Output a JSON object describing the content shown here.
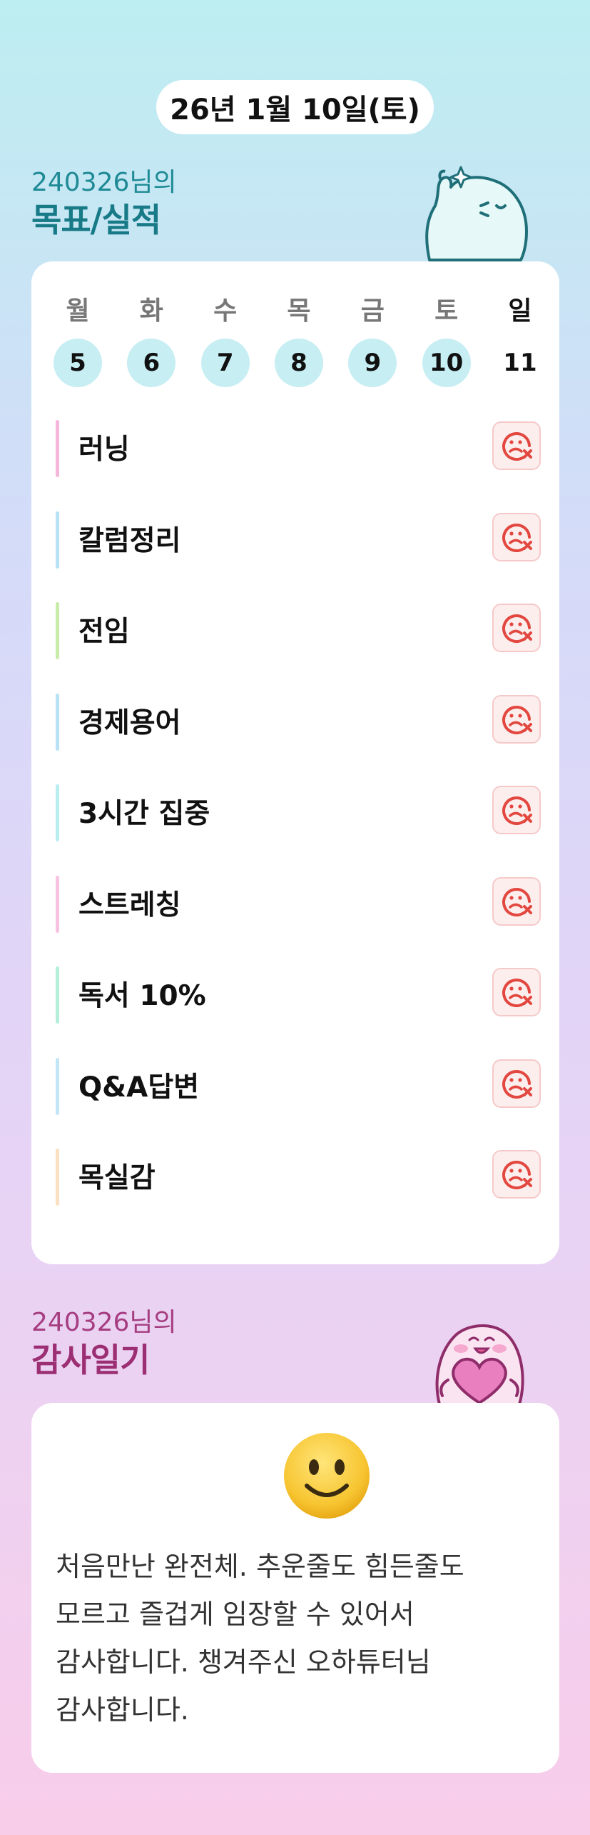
{
  "date_label": "26년 1월 10일(토)",
  "goals_section": {
    "user_line": "240326님의",
    "title": "목표/실적"
  },
  "week": {
    "days": [
      {
        "name": "월",
        "num": "5"
      },
      {
        "name": "화",
        "num": "6"
      },
      {
        "name": "수",
        "num": "7"
      },
      {
        "name": "목",
        "num": "8"
      },
      {
        "name": "금",
        "num": "9"
      },
      {
        "name": "토",
        "num": "10"
      },
      {
        "name": "일",
        "num": "11"
      }
    ]
  },
  "goals": [
    {
      "label": "러닝",
      "color": "#f6b6dc",
      "status": "sad-x-icon"
    },
    {
      "label": "칼럼정리",
      "color": "#b9e2f6",
      "status": "sad-x-icon"
    },
    {
      "label": "전임",
      "color": "#c8ecaa",
      "status": "sad-x-icon"
    },
    {
      "label": "경제용어",
      "color": "#b9e2f6",
      "status": "sad-x-icon"
    },
    {
      "label": "3시간 집중",
      "color": "#b8eef0",
      "status": "sad-x-icon"
    },
    {
      "label": "스트레칭",
      "color": "#f8c2e2",
      "status": "sad-x-icon"
    },
    {
      "label": "독서 10%",
      "color": "#b5efd9",
      "status": "sad-x-icon"
    },
    {
      "label": "Q&A답변",
      "color": "#c2e6f7",
      "status": "sad-x-icon"
    },
    {
      "label": "목실감",
      "color": "#fbe1c2",
      "status": "sad-x-icon"
    }
  ],
  "gratitude_section": {
    "user_line": "240326님의",
    "title": "감사일기",
    "emoji": "slightly-smiling-face-icon",
    "text": "처음만난 완전체. 추운줄도 힘든줄도 모르고 즐겁게 임장할 수 있어서 감사합니다. 챙겨주신 오하튜터님 감사합니다."
  }
}
